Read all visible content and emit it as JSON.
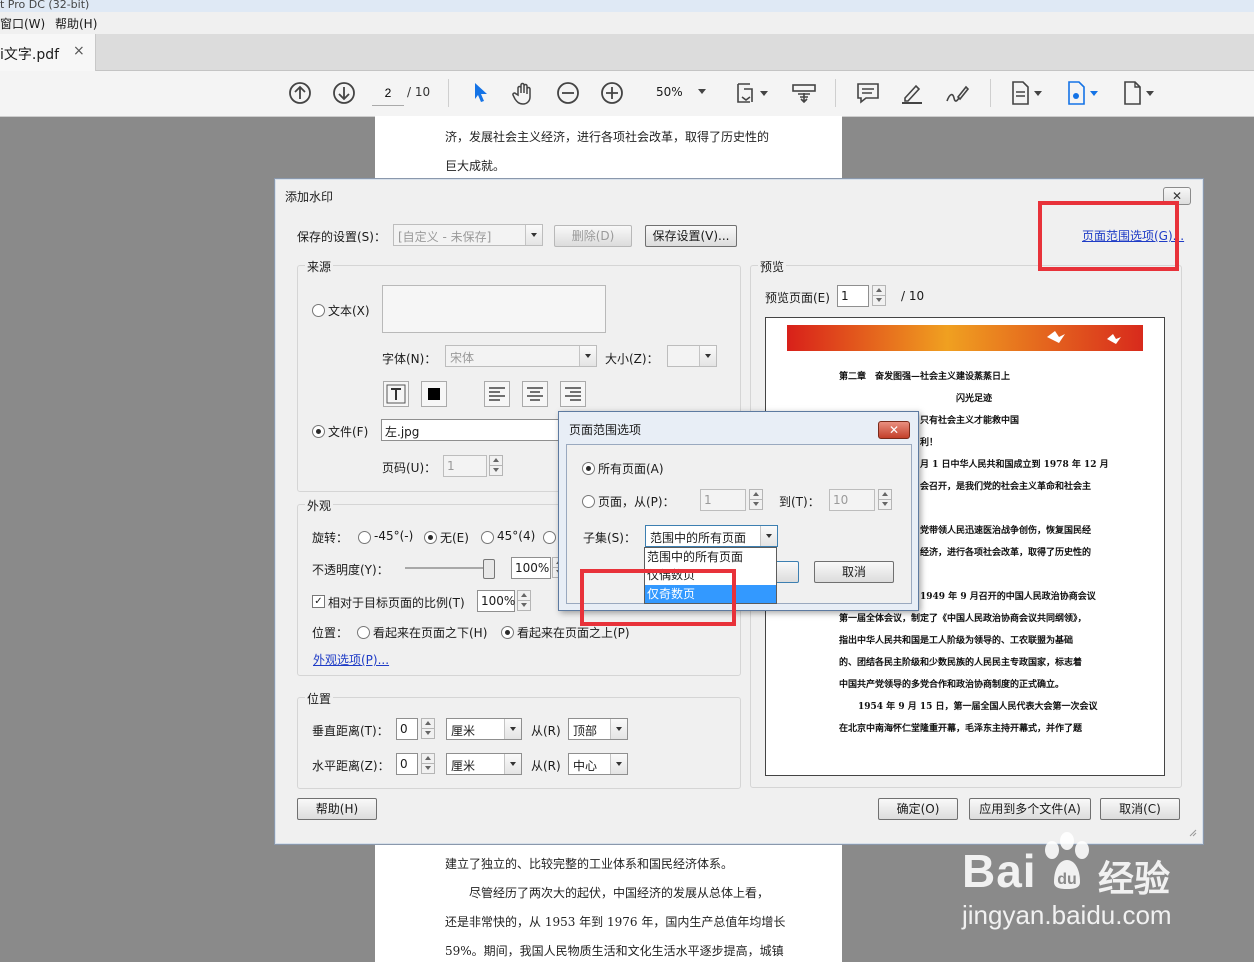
{
  "app": {
    "title_fragment": "t Pro DC (32-bit)",
    "menu": [
      "窗口(W)",
      "帮助(H)"
    ],
    "tab_name": "i文字.pdf",
    "tab_close": "×"
  },
  "toolbar": {
    "page_current": "2",
    "page_total": "/ 10",
    "zoom": "50%"
  },
  "document": {
    "top_lines": [
      "济，发展社会主义经济，进行各项社会改革，取得了历史性的",
      "巨大成就。"
    ],
    "bottom_lines": [
      "建立了独立的、比较完整的工业体系和国民经济体系。",
      "尽管经历了两次大的起伏，中国经济的发展从总体上看，",
      "还是非常快的，从 1953 年到 1976 年，国内生产总值年均增长",
      "59%。期间，我国人民物质生活和文化生活水平逐步提高，城镇"
    ]
  },
  "dialog": {
    "title": "添加水印",
    "close": "✕",
    "saved_settings_label": "保存的设置(S)：",
    "saved_settings_value": "[自定义 - 未保存]",
    "delete_button": "删除(D)",
    "save_settings_button": "保存设置(V)...",
    "page_range_link": "页面范围选项(G)...",
    "source": {
      "heading": "来源",
      "text_option": "文本(X)",
      "font_label": "字体(N)：",
      "font_value": "宋体",
      "size_label": "大小(Z)：",
      "file_option": "文件(F)",
      "file_value": "左.jpg",
      "page_num_label": "页码(U)：",
      "page_num_value": "1"
    },
    "appearance": {
      "heading": "外观",
      "rotate_label": "旋转：",
      "rotate_options": [
        "-45°(-)",
        "无(E)",
        "45°(4)"
      ],
      "opacity_label": "不透明度(Y)：",
      "opacity_value": "100%",
      "opacity_level": 1.0,
      "scale_label": "相对于目标页面的比例(T)",
      "scale_value": "100%",
      "position_label": "位置：",
      "behind_option": "看起来在页面之下(H)",
      "front_option": "看起来在页面之上(P)",
      "options_link": "外观选项(P)..."
    },
    "position": {
      "heading": "位置",
      "vertical_label": "垂直距离(T)：",
      "vertical_value": "0",
      "vertical_unit": "厘米",
      "vertical_from_label": "从(R)",
      "vertical_from": "顶部",
      "horizontal_label": "水平距离(Z)：",
      "horizontal_value": "0",
      "horizontal_unit": "厘米",
      "horizontal_from_label": "从(R)",
      "horizontal_from": "中心"
    },
    "preview": {
      "heading": "预览",
      "page_label": "预览页面(E)",
      "page_value": "1",
      "page_total": "/ 10",
      "lines": [
        "第二章　奋发图强—社会主义建设蒸蒸日上",
        "闪光足迹",
        "只有社会主义才能救中国",
        "利！",
        "月 1 日中华人民共和国成立到 1978 年 12 月",
        "会召开，是我们党的社会主义革命和社会主",
        "党带领人民迅速医治战争创伤，恢复国民经",
        "经济，进行各项社会改革，取得了历史性的",
        "1949 年 9 月召开的中国人民政治协商会议",
        "第一届全体会议，制定了《中国人民政治协商会议共同纲领》，",
        "指出中华人民共和国是工人阶级为领导的、工农联盟为基础",
        "的、团结各民主阶级和少数民族的人民民主专政国家，标志着",
        "中国共产党领导的多党合作和政治协商制度的正式确立。",
        "1954 年 9 月 15 日，第一届全国人民代表大会第一次会议",
        "在北京中南海怀仁堂隆重开幕，毛泽东主持开幕式，并作了题"
      ]
    },
    "help_button": "帮助(H)",
    "ok_button": "确定(O)",
    "apply_multiple_button": "应用到多个文件(A)",
    "cancel_button": "取消(C)"
  },
  "subdialog": {
    "title": "页面范围选项",
    "close": "✕",
    "all_pages": "所有页面(A)",
    "pages_from": "页面，从(P)：",
    "from_value": "1",
    "to_label": "到(T)：",
    "to_value": "10",
    "subset_label": "子集(S)：",
    "subset_value": "范围中的所有页面",
    "cancel_button": "取消",
    "dropdown_options": [
      "范围中的所有页面",
      "仅偶数页",
      "仅奇数页"
    ]
  },
  "watermark": {
    "brand_a": "Bai",
    "brand_b": "经验",
    "url": "jingyan.baidu.com"
  },
  "colors": {
    "highlight": "#e8323a",
    "link": "#1f3cc6",
    "selection": "#3399ff",
    "toolbar_blue": "#1473e6"
  }
}
